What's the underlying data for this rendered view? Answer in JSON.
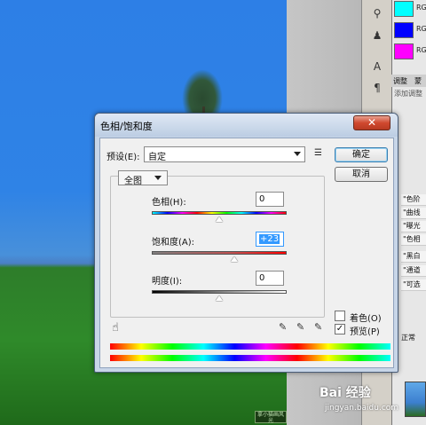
{
  "dialog": {
    "title": "色相/饱和度",
    "close_symbol": "✕",
    "preset_label": "预设(E):",
    "preset_value": "自定",
    "ok_label": "确定",
    "cancel_label": "取消",
    "channel_value": "全图",
    "sliders": [
      {
        "label": "色相(H):",
        "value": "0",
        "level": 0.5
      },
      {
        "label": "饱和度(A):",
        "value": "+23",
        "level": 0.615
      },
      {
        "label": "明度(I):",
        "value": "0",
        "level": 0.5
      }
    ],
    "colorize_label": "着色(O)",
    "colorize_checked": false,
    "preview_label": "预览(P)",
    "preview_checked": true,
    "preview_check_mark": "✓"
  },
  "swatches": [
    {
      "color": "#00ffff",
      "label": "RG"
    },
    {
      "color": "#0000ff",
      "label": "RG"
    },
    {
      "color": "#ff00ff",
      "label": "RG"
    }
  ],
  "panel": {
    "tabs": [
      "调整",
      "蒙"
    ],
    "hint": "添加调整",
    "adjustment_items": [
      "\"色阶",
      "\"曲线",
      "\"曝光",
      "\"色相",
      "\"黑白",
      "\"通道",
      "\"可选"
    ],
    "mode_text": "正常"
  },
  "watermark": {
    "text": "Bai 经验",
    "url": "jingyan.baidu.com"
  },
  "canvas_label": "拿小猫画风光"
}
